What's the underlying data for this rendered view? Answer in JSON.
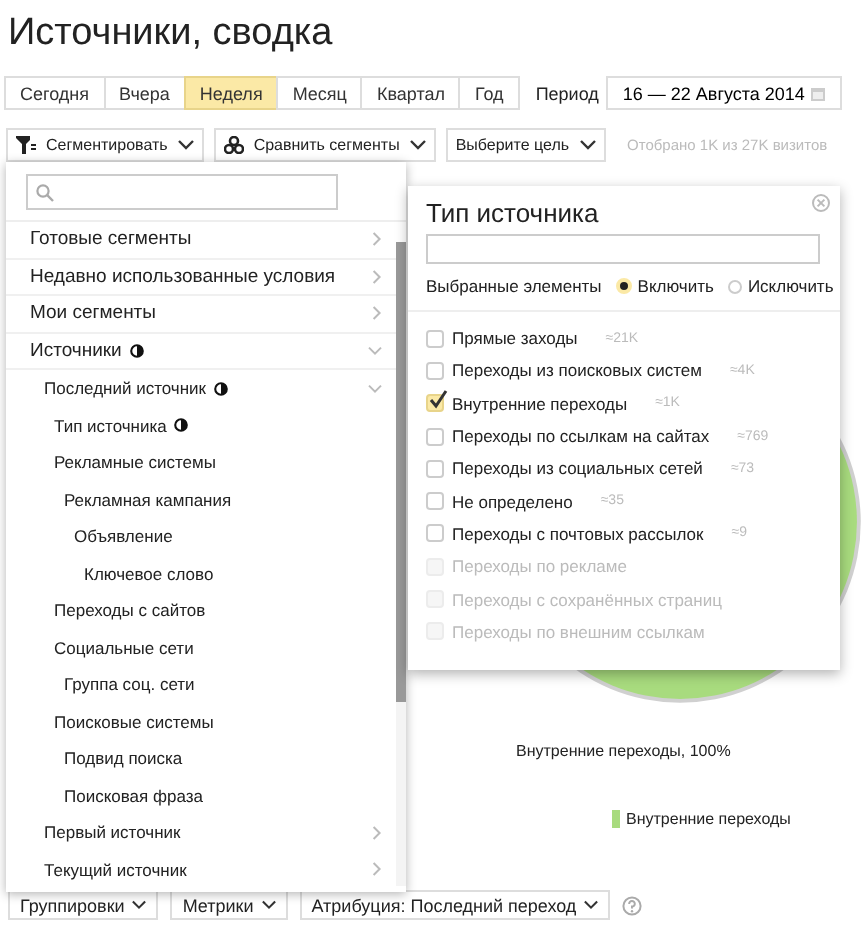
{
  "title": "Источники, сводка",
  "period_tabs": [
    {
      "label": "Сегодня",
      "selected": false
    },
    {
      "label": "Вчера",
      "selected": false
    },
    {
      "label": "Неделя",
      "selected": true
    },
    {
      "label": "Месяц",
      "selected": false
    },
    {
      "label": "Квартал",
      "selected": false
    },
    {
      "label": "Год",
      "selected": false
    }
  ],
  "period": {
    "label": "Период",
    "value": "16 — 22 Августа 2014"
  },
  "toolbar": {
    "segment_button": "Сегментировать",
    "compare_button": "Сравнить сегменты",
    "goal_button": "Выберите цель",
    "sample_info": "Отобрано 1K из 27K визитов"
  },
  "segment_menu": {
    "items": [
      {
        "label": "Готовые сегменты",
        "expanded": false,
        "filtered": false
      },
      {
        "label": "Недавно использованные условия",
        "expanded": false,
        "filtered": false
      },
      {
        "label": "Мои сегменты",
        "expanded": false,
        "filtered": false
      },
      {
        "label": "Источники",
        "expanded": true,
        "filtered": true,
        "children": [
          {
            "label": "Последний источник",
            "expanded": true,
            "filtered": true,
            "children": [
              {
                "label": "Тип источника",
                "filtered": true
              },
              {
                "label": "Рекламные системы",
                "filtered": false,
                "children": [
                  {
                    "label": "Рекламная кампания",
                    "filtered": false,
                    "children": [
                      {
                        "label": "Объявление",
                        "filtered": false,
                        "children": [
                          {
                            "label": "Ключевое слово",
                            "filtered": false
                          }
                        ]
                      }
                    ]
                  }
                ]
              },
              {
                "label": "Переходы с сайтов",
                "filtered": false
              },
              {
                "label": "Социальные сети",
                "filtered": false,
                "children": [
                  {
                    "label": "Группа соц. сети",
                    "filtered": false
                  }
                ]
              },
              {
                "label": "Поисковые системы",
                "filtered": false,
                "children": [
                  {
                    "label": "Подвид поиска",
                    "filtered": false
                  },
                  {
                    "label": "Поисковая фраза",
                    "filtered": false
                  }
                ]
              }
            ]
          },
          {
            "label": "Первый источник",
            "expanded": false,
            "filtered": false
          },
          {
            "label": "Текущий источник",
            "expanded": false,
            "filtered": false
          }
        ]
      }
    ]
  },
  "filter_popup": {
    "title": "Тип источника",
    "mode_label": "Выбранные элементы",
    "modes": [
      {
        "label": "Включить",
        "selected": true
      },
      {
        "label": "Исключить",
        "selected": false
      }
    ],
    "options": [
      {
        "label": "Прямые заходы",
        "count": "≈21K",
        "checked": false,
        "disabled": false
      },
      {
        "label": "Переходы из поисковых систем",
        "count": "≈4K",
        "checked": false,
        "disabled": false
      },
      {
        "label": "Внутренние переходы",
        "count": "≈1K",
        "checked": true,
        "disabled": false
      },
      {
        "label": "Переходы по ссылкам на сайтах",
        "count": "≈769",
        "checked": false,
        "disabled": false
      },
      {
        "label": "Переходы из социальных сетей",
        "count": "≈73",
        "checked": false,
        "disabled": false
      },
      {
        "label": "Не определено",
        "count": "≈35",
        "checked": false,
        "disabled": false
      },
      {
        "label": "Переходы с почтовых рассылок",
        "count": "≈9",
        "checked": false,
        "disabled": false
      },
      {
        "label": "Переходы по рекламе",
        "checked": false,
        "disabled": true
      },
      {
        "label": "Переходы с сохранённых страниц",
        "checked": false,
        "disabled": true
      },
      {
        "label": "Переходы по внешним ссылкам",
        "checked": false,
        "disabled": true
      }
    ]
  },
  "chart": {
    "slice_label": "Внутренние переходы, 100%",
    "legend": [
      {
        "label": "Внутренние переходы",
        "color": "#a8db7e"
      }
    ]
  },
  "bottom_bar": {
    "buttons": [
      "Группировки",
      "Метрики",
      "Атрибуция: Последний переход"
    ]
  }
}
